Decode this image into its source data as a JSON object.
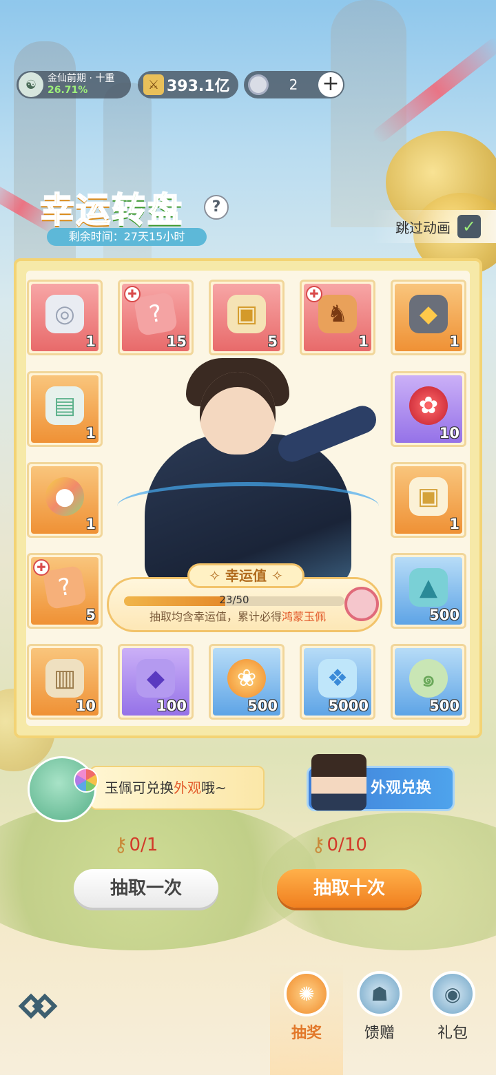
{
  "header": {
    "rank_title": "金仙前期 · 十重",
    "rank_progress": "26.71%",
    "power_value": "393.1亿",
    "currency_count": "2",
    "add_label": "+"
  },
  "event": {
    "title_part1": "幸运",
    "title_part2": "转盘",
    "remaining_time": "剩余时间：27天15小时",
    "help_label": "?",
    "skip_label": "跳过动画",
    "skip_checked": true
  },
  "grid": {
    "row1": [
      {
        "qty": "1",
        "icon": "jade-pendant-icon",
        "bg": "red"
      },
      {
        "qty": "15",
        "icon": "mystery-book-icon",
        "bg": "red",
        "badge": true
      },
      {
        "qty": "5",
        "icon": "dragon-chest-icon",
        "bg": "red"
      },
      {
        "qty": "1",
        "icon": "golden-chariot-icon",
        "bg": "red",
        "badge": true
      },
      {
        "qty": "1",
        "icon": "fire-ore-icon",
        "bg": "orange"
      }
    ],
    "left_col": [
      {
        "qty": "1",
        "icon": "scroll-map-icon",
        "bg": "orange"
      },
      {
        "qty": "1",
        "icon": "rainbow-mango-icon",
        "bg": "orange"
      },
      {
        "qty": "5",
        "icon": "mystery-book-icon",
        "bg": "orange",
        "badge": true
      }
    ],
    "right_col": [
      {
        "qty": "10",
        "icon": "red-fruit-icon",
        "bg": "purple"
      },
      {
        "qty": "1",
        "icon": "gold-chest-icon",
        "bg": "orange"
      },
      {
        "qty": "500",
        "icon": "jade-pyramid-icon",
        "bg": "blue"
      }
    ],
    "row5": [
      {
        "qty": "10",
        "icon": "ancient-scroll-icon",
        "bg": "orange"
      },
      {
        "qty": "100",
        "icon": "purple-crystal-icon",
        "bg": "purple"
      },
      {
        "qty": "500",
        "icon": "lotus-fruit-icon",
        "bg": "blue"
      },
      {
        "qty": "5000",
        "icon": "blue-crystal-icon",
        "bg": "blue"
      },
      {
        "qty": "500",
        "icon": "green-jade-icon",
        "bg": "blue"
      }
    ]
  },
  "luck": {
    "title": "幸运值",
    "value_text": "23/50",
    "progress": 0.46,
    "desc_prefix": "抽取均含幸运值，累计必得",
    "desc_highlight": "鸿蒙玉佩"
  },
  "promo": {
    "tip_prefix": "玉佩可兑换",
    "tip_highlight": "外观",
    "tip_suffix": "哦~",
    "exchange_label": "外观兑换"
  },
  "draw": {
    "one_keys": "0/1",
    "ten_keys": "0/10",
    "one_label": "抽取一次",
    "ten_label": "抽取十次"
  },
  "nav": {
    "tabs": [
      {
        "label": "抽奖",
        "active": true
      },
      {
        "label": "馈赠",
        "active": false
      },
      {
        "label": "礼包",
        "active": false
      }
    ]
  }
}
